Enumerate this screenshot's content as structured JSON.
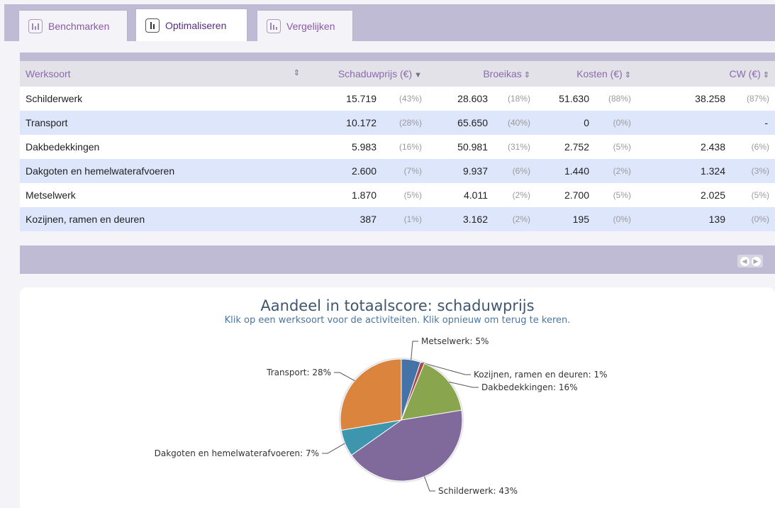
{
  "tabs": [
    {
      "label": "Benchmarken",
      "icon": "benchmark-icon",
      "active": false
    },
    {
      "label": "Optimaliseren",
      "icon": "optimize-icon",
      "active": true
    },
    {
      "label": "Vergelijken",
      "icon": "compare-icon",
      "active": false
    }
  ],
  "table": {
    "headers": {
      "werksoort": "Werksoort",
      "schaduwprijs": "Schaduwprijs (€)",
      "broeikas": "Broeikas",
      "kosten": "Kosten (€)",
      "cw": "CW (€)"
    },
    "rows": [
      {
        "werksoort": "Schilderwerk",
        "schaduwprijs": "15.719",
        "schaduwprijs_pct": "(43%)",
        "broeikas": "28.603",
        "broeikas_pct": "(18%)",
        "kosten": "51.630",
        "kosten_pct": "(88%)",
        "cw": "38.258",
        "cw_pct": "(87%)"
      },
      {
        "werksoort": "Transport",
        "schaduwprijs": "10.172",
        "schaduwprijs_pct": "(28%)",
        "broeikas": "65.650",
        "broeikas_pct": "(40%)",
        "kosten": "0",
        "kosten_pct": "(0%)",
        "cw": "",
        "cw_pct": "-"
      },
      {
        "werksoort": "Dakbedekkingen",
        "schaduwprijs": "5.983",
        "schaduwprijs_pct": "(16%)",
        "broeikas": "50.981",
        "broeikas_pct": "(31%)",
        "kosten": "2.752",
        "kosten_pct": "(5%)",
        "cw": "2.438",
        "cw_pct": "(6%)"
      },
      {
        "werksoort": "Dakgoten en hemelwaterafvoeren",
        "schaduwprijs": "2.600",
        "schaduwprijs_pct": "(7%)",
        "broeikas": "9.937",
        "broeikas_pct": "(6%)",
        "kosten": "1.440",
        "kosten_pct": "(2%)",
        "cw": "1.324",
        "cw_pct": "(3%)"
      },
      {
        "werksoort": "Metselwerk",
        "schaduwprijs": "1.870",
        "schaduwprijs_pct": "(5%)",
        "broeikas": "4.011",
        "broeikas_pct": "(2%)",
        "kosten": "2.700",
        "kosten_pct": "(5%)",
        "cw": "2.025",
        "cw_pct": "(5%)"
      },
      {
        "werksoort": "Kozijnen, ramen en deuren",
        "schaduwprijs": "387",
        "schaduwprijs_pct": "(1%)",
        "broeikas": "3.162",
        "broeikas_pct": "(2%)",
        "kosten": "195",
        "kosten_pct": "(0%)",
        "cw": "139",
        "cw_pct": "(0%)"
      }
    ]
  },
  "pager": {
    "prev_icon": "prev-icon",
    "next_icon": "next-icon"
  },
  "chart": {
    "title": "Aandeel in totaalscore: schaduwprijs",
    "subtitle": "Klik op een werksoort voor de activiteiten. Klik opnieuw om terug te keren."
  },
  "chart_data": {
    "type": "pie",
    "title": "Aandeel in totaalscore: schaduwprijs",
    "slices": [
      {
        "name": "Metselwerk",
        "value": 1870,
        "label": "Metselwerk: 5%",
        "color": "#4572a7"
      },
      {
        "name": "Kozijnen, ramen en deuren",
        "value": 387,
        "label": "Kozijnen, ramen en deuren: 1%",
        "color": "#aa4643"
      },
      {
        "name": "Dakbedekkingen",
        "value": 5983,
        "label": "Dakbedekkingen: 16%",
        "color": "#89a54e"
      },
      {
        "name": "Schilderwerk",
        "value": 15719,
        "label": "Schilderwerk: 43%",
        "color": "#80699b"
      },
      {
        "name": "Dakgoten en hemelwaterafvoeren",
        "value": 2600,
        "label": "Dakgoten en hemelwaterafvoeren: 7%",
        "color": "#3d96ae"
      },
      {
        "name": "Transport",
        "value": 10172,
        "label": "Transport: 28%",
        "color": "#db843d"
      }
    ]
  }
}
